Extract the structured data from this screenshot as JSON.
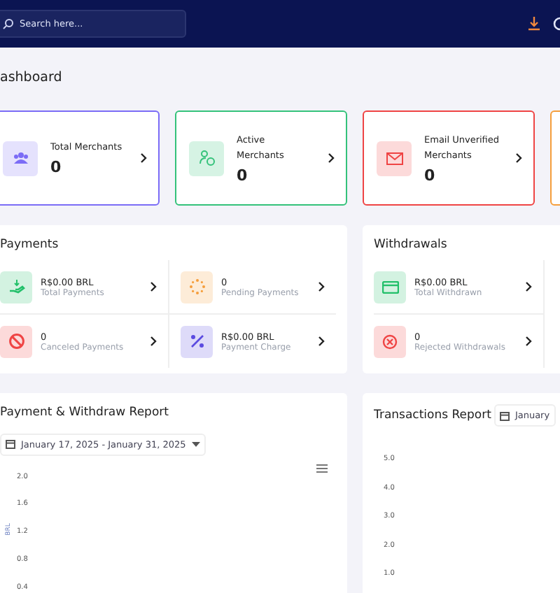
{
  "search": {
    "placeholder": "Search here..."
  },
  "page_title": "ashboard",
  "stat_cards": [
    {
      "label": "Total Merchants",
      "value": "0",
      "color": "#7b6cf6"
    },
    {
      "label": "Active Merchants",
      "value": "0",
      "color": "#34c27a"
    },
    {
      "label": "Email Unverified Merchants",
      "value": "0",
      "color": "#ef4444"
    },
    {
      "color": "#f59e3b"
    }
  ],
  "payments": {
    "title": "Payments",
    "items": [
      {
        "value": "R$0.00 BRL",
        "label": "Total Payments",
        "color": "#22c06a"
      },
      {
        "value": "0",
        "label": "Pending Payments",
        "color": "#f59e3b"
      },
      {
        "value": "0",
        "label": "Canceled Payments",
        "color": "#ef4444"
      },
      {
        "value": "R$0.00 BRL",
        "label": "Payment Charge",
        "color": "#5b4be0"
      }
    ]
  },
  "withdrawals": {
    "title": "Withdrawals",
    "items": [
      {
        "value": "R$0.00 BRL",
        "label": "Total Withdrawn",
        "color": "#22c06a"
      },
      {
        "value": "0",
        "label": "Rejected Withdrawals",
        "color": "#ef4444"
      }
    ]
  },
  "payment_report": {
    "title": "Payment & Withdraw Report",
    "date_range": "January 17, 2025 - January 31, 2025",
    "axis_label": "BRL",
    "axis_values": [
      "2.0",
      "1.6",
      "1.2",
      "0.8",
      "0.4"
    ]
  },
  "transactions_report": {
    "title": "Transactions Report",
    "date_range": "January",
    "axis_values": [
      "5.0",
      "4.0",
      "3.0",
      "2.0",
      "1.0"
    ]
  }
}
